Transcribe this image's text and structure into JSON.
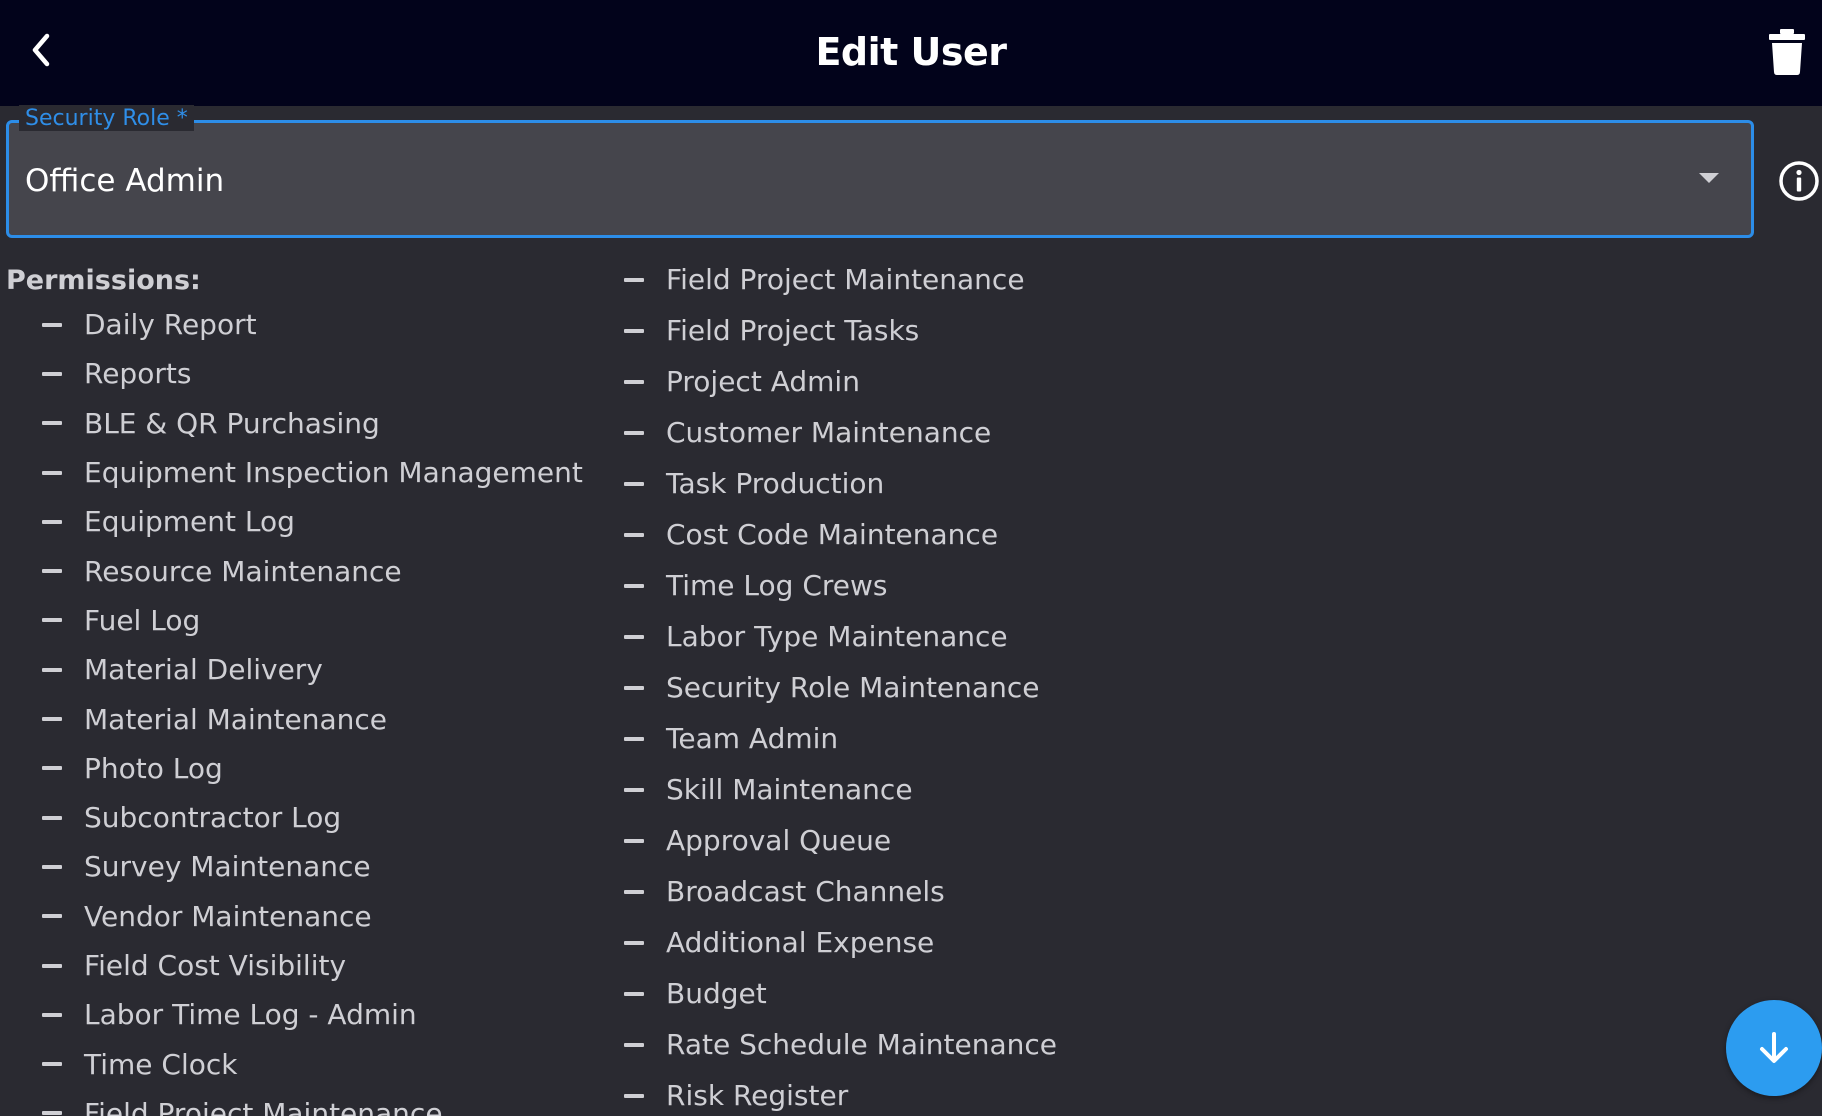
{
  "header": {
    "title": "Edit User",
    "back_icon": "chevron-left-icon",
    "delete_icon": "trash-icon"
  },
  "security_role": {
    "label": "Security Role *",
    "value": "Office Admin",
    "accent_color": "#2c8de8"
  },
  "permissions": {
    "label": "Permissions:",
    "left_column": [
      "Daily Report",
      "Reports",
      "BLE & QR Purchasing",
      "Equipment Inspection Management",
      "Equipment Log",
      "Resource Maintenance",
      "Fuel Log",
      "Material Delivery",
      "Material Maintenance",
      "Photo Log",
      "Subcontractor Log",
      "Survey Maintenance",
      "Vendor Maintenance",
      "Field Cost Visibility",
      "Labor Time Log - Admin",
      "Time Clock",
      "Field Project Maintenance"
    ],
    "right_column": [
      "Field Project Maintenance",
      "Field Project Tasks",
      "Project Admin",
      "Customer Maintenance",
      "Task Production",
      "Cost Code Maintenance",
      "Time Log Crews",
      "Labor Type Maintenance",
      "Security Role Maintenance",
      "Team Admin",
      "Skill Maintenance",
      "Approval Queue",
      "Broadcast Channels",
      "Additional Expense",
      "Budget",
      "Rate Schedule Maintenance",
      "Risk Register"
    ]
  },
  "scroll_down_icon": "arrow-down-icon",
  "info_icon": "info-icon",
  "colors": {
    "header_bg": "#02031b",
    "page_bg": "#2a2a31",
    "fab": "#2c9cf0"
  }
}
